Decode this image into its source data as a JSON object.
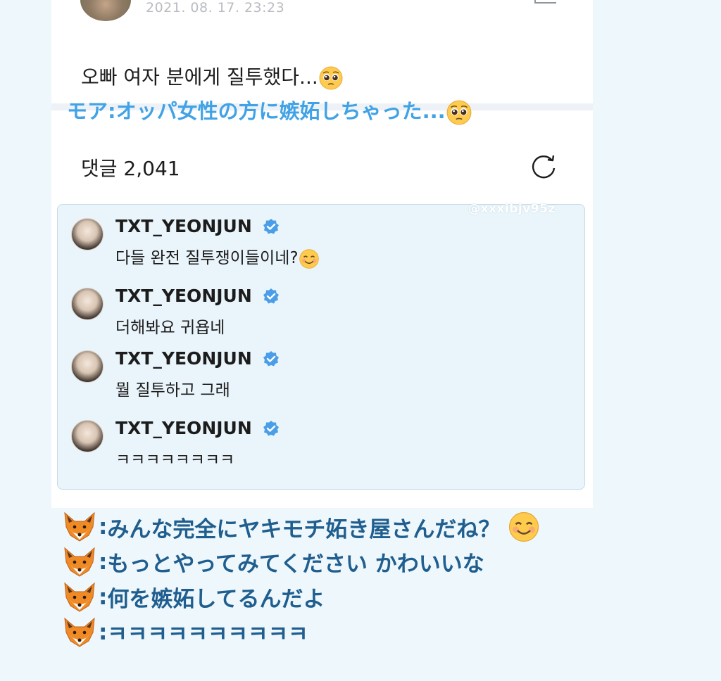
{
  "post": {
    "timestamp": "2021. 08. 17. 23:23",
    "text": "오빠 여자 분에게 질투했다...",
    "translation": "モア:オッパ女性の方に嫉妬しちゃった...",
    "emoji": "pleading-face-icon"
  },
  "comments_section": {
    "count_label": "댓글 2,041",
    "watermark": "@xxxibjv95z"
  },
  "comments": [
    {
      "username": "TXT_YEONJUN",
      "text": "다들 완전 질투쟁이들이네?"
    },
    {
      "username": "TXT_YEONJUN",
      "text": "더해봐요 귀욥네"
    },
    {
      "username": "TXT_YEONJUN",
      "text": "뭘 질투하고 그래"
    },
    {
      "username": "TXT_YEONJUN",
      "text": "ㅋㅋㅋㅋㅋㅋㅋㅋ"
    }
  ],
  "translations": [
    {
      "prefix": ":",
      "text": "みんな完全にヤキモチ妬き屋さんだね？"
    },
    {
      "prefix": ":",
      "text": "もっとやってみてください かわいいな"
    },
    {
      "prefix": ":",
      "text": "何を嫉妬してるんだよ"
    },
    {
      "prefix": ":",
      "text": " ㅋㅋㅋㅋㅋㅋㅋㅋㅋㅋ"
    }
  ],
  "colors": {
    "translation_blue": "#41a3e6",
    "bottom_text": "#1f5e8e",
    "verified": "#4a9ee8",
    "comment_bg": "#eaf5fb"
  }
}
